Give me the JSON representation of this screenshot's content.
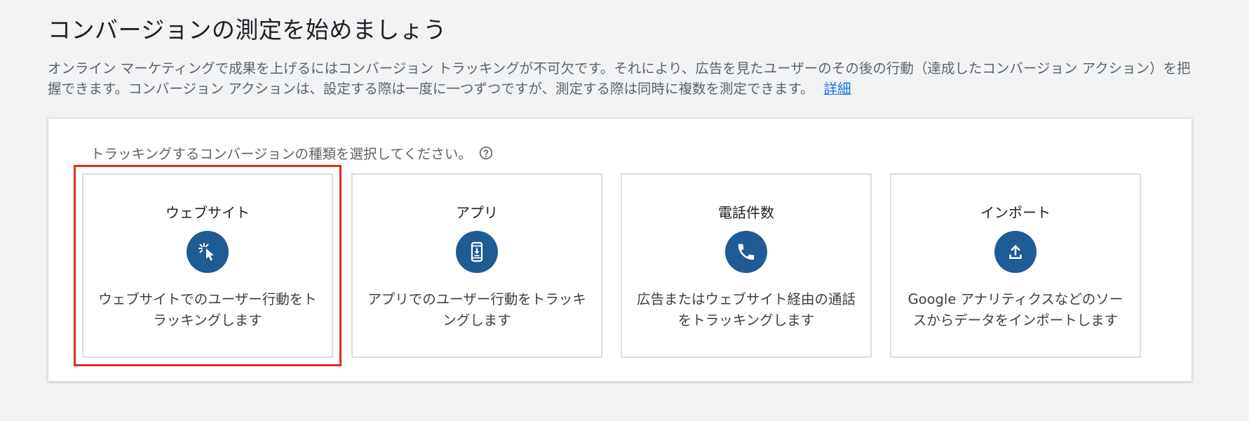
{
  "page": {
    "title": "コンバージョンの測定を始めましょう",
    "description": "オンライン マーケティングで成果を上げるにはコンバージョン トラッキングが不可欠です。それにより、広告を見たユーザーのその後の行動（達成したコンバージョン アクション）を把握できます。コンバージョン アクションは、設定する際は一度に一つずつですが、測定する際は同時に複数を測定できます。",
    "details_link": "詳細"
  },
  "selector": {
    "label": "トラッキングするコンバージョンの種類を選択してください。",
    "help_icon": "help-circle-icon",
    "cards": [
      {
        "title": "ウェブサイト",
        "icon": "cursor-click-icon",
        "description": "ウェブサイトでのユーザー行動をトラッキングします",
        "highlighted": true
      },
      {
        "title": "アプリ",
        "icon": "phone-download-icon",
        "description": "アプリでのユーザー行動をトラッキングします",
        "highlighted": false
      },
      {
        "title": "電話件数",
        "icon": "phone-call-icon",
        "description": "広告またはウェブサイト経由の通話をトラッキングします",
        "highlighted": false
      },
      {
        "title": "インポート",
        "icon": "upload-icon",
        "description": "Google アナリティクスなどのソースからデータをインポートします",
        "highlighted": false
      }
    ]
  },
  "colors": {
    "background": "#f1f3f4",
    "icon_circle": "#1f5b94",
    "highlight_border": "#d93025",
    "link": "#1a73e8"
  }
}
